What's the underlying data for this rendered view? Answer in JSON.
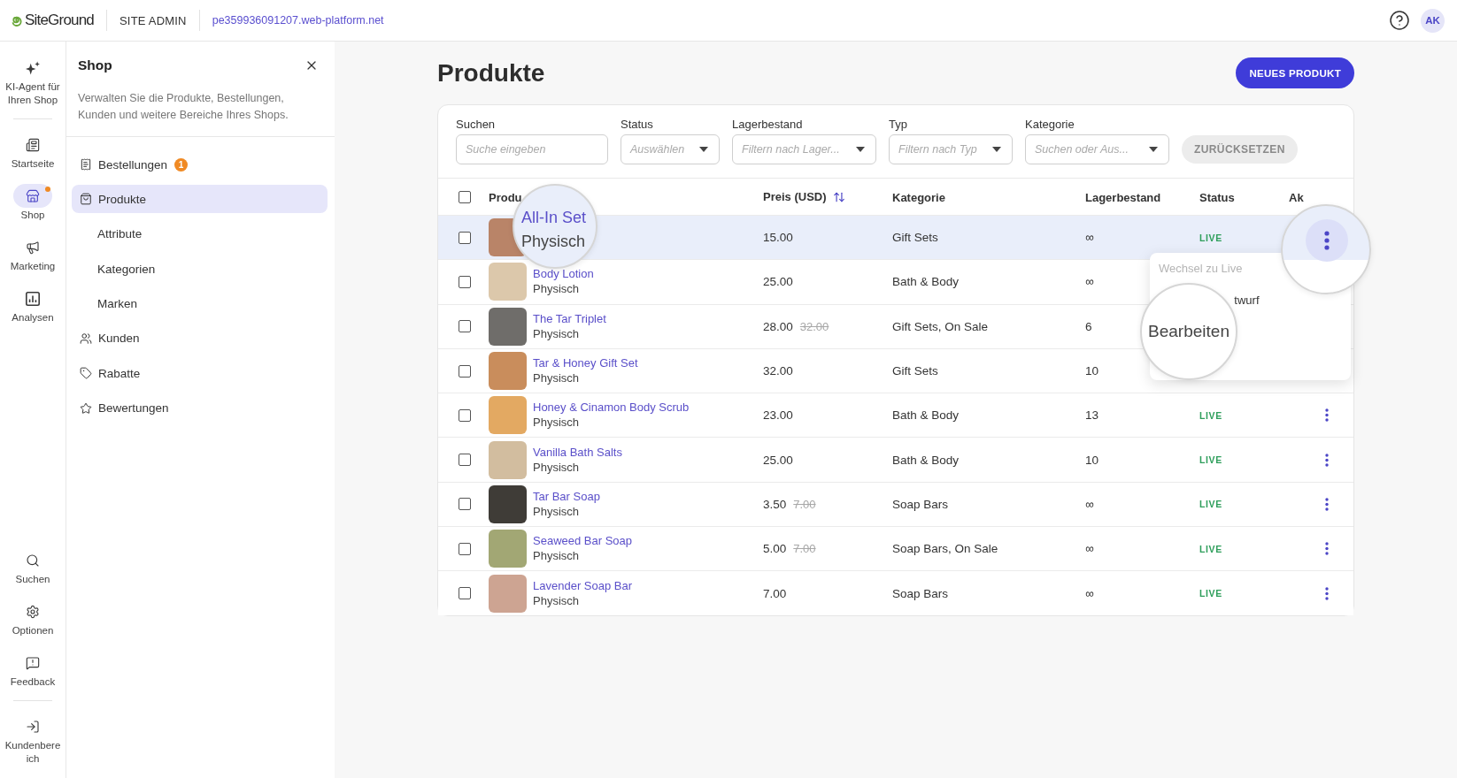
{
  "header": {
    "logo": "SiteGround",
    "section": "SITE ADMIN",
    "domain": "pe359936091207.web-platform.net",
    "avatar": "AK"
  },
  "rail": {
    "top_sections": [
      {
        "items": [
          {
            "label": "KI-Agent für Ihren Shop",
            "selected": false,
            "notification": false
          }
        ]
      },
      {
        "items": [
          {
            "label": "Startseite",
            "selected": false,
            "notification": false
          },
          {
            "label": "Shop",
            "selected": true,
            "notification": true
          },
          {
            "label": "Marketing",
            "selected": false,
            "notification": false
          },
          {
            "label": "Analysen",
            "selected": false,
            "notification": false
          }
        ]
      }
    ],
    "bottom_sections": [
      {
        "items": [
          {
            "label": "Suchen",
            "selected": false,
            "notification": false
          },
          {
            "label": "Optionen",
            "selected": false,
            "notification": false
          },
          {
            "label": "Feedback",
            "selected": false,
            "notification": false
          }
        ]
      },
      {
        "items": [
          {
            "label": "Kundenbereich",
            "selected": false,
            "notification": false
          }
        ]
      }
    ]
  },
  "shop_panel": {
    "title": "Shop",
    "description": "Verwalten Sie die Produkte, Bestellungen, Kunden und weitere Bereiche Ihres Shops.",
    "items": [
      {
        "label": "Bestellungen",
        "badge": "1",
        "selected": false
      },
      {
        "label": "Produkte",
        "selected": true,
        "children": [
          {
            "label": "Attribute",
            "selected": false
          },
          {
            "label": "Kategorien",
            "selected": false
          },
          {
            "label": "Marken",
            "selected": false
          }
        ]
      },
      {
        "label": "Kunden",
        "selected": false
      },
      {
        "label": "Rabatte",
        "selected": false
      },
      {
        "label": "Bewertungen",
        "selected": false
      }
    ]
  },
  "main": {
    "title": "Produkte",
    "new_button": "NEUES PRODUKT",
    "filters": [
      {
        "kind": "text",
        "label": "Suchen",
        "placeholder": "Suche eingeben"
      },
      {
        "kind": "select",
        "label": "Status",
        "placeholder": "Auswählen"
      },
      {
        "kind": "select",
        "label": "Lagerbestand",
        "placeholder": "Filtern nach Lager..."
      },
      {
        "kind": "select",
        "label": "Typ",
        "placeholder": "Filtern nach Typ"
      },
      {
        "kind": "select",
        "label": "Kategorie",
        "placeholder": "Suchen oder Aus..."
      }
    ],
    "reset_button": {
      "label": "ZURÜCKSETZEN",
      "disabled": true
    },
    "table": {
      "select_all": {
        "checked": false
      },
      "columns": [
        {
          "label": "Produ"
        },
        {
          "label": "Preis (USD)",
          "sortable": true
        },
        {
          "label": "Kategorie"
        },
        {
          "label": "Lagerbestand"
        },
        {
          "label": "Status"
        },
        {
          "label": "Ak"
        }
      ],
      "rows": [
        {
          "checked": false,
          "selected": true,
          "price": "15.00",
          "category": "Gift Sets",
          "stock": "∞",
          "status": "LIVE"
        },
        {
          "checked": false,
          "selected": false,
          "name": "Body Lotion",
          "type": "Physisch",
          "price": "25.00",
          "category": "Bath & Body",
          "stock": "∞"
        },
        {
          "checked": false,
          "selected": false,
          "name": "The Tar Triplet",
          "type": "Physisch",
          "price": "28.00",
          "old_price": "32.00",
          "category": "Gift Sets, On Sale",
          "stock": "6"
        },
        {
          "checked": false,
          "selected": false,
          "name": "Tar & Honey Gift Set",
          "type": "Physisch",
          "price": "32.00",
          "category": "Gift Sets",
          "stock": "10"
        },
        {
          "checked": false,
          "selected": false,
          "name": "Honey & Cinamon Body Scrub",
          "type": "Physisch",
          "price": "23.00",
          "category": "Bath & Body",
          "stock": "13",
          "status": "LIVE",
          "has_actions": true
        },
        {
          "checked": false,
          "selected": false,
          "name": "Vanilla Bath Salts",
          "type": "Physisch",
          "price": "25.00",
          "category": "Bath & Body",
          "stock": "10",
          "status": "LIVE",
          "has_actions": true
        },
        {
          "checked": false,
          "selected": false,
          "name": "Tar Bar Soap",
          "type": "Physisch",
          "price": "3.50",
          "old_price": "7.00",
          "category": "Soap Bars",
          "stock": "∞",
          "status": "LIVE",
          "has_actions": true
        },
        {
          "checked": false,
          "selected": false,
          "name": "Seaweed Bar Soap",
          "type": "Physisch",
          "price": "5.00",
          "old_price": "7.00",
          "category": "Soap Bars, On Sale",
          "stock": "∞",
          "status": "LIVE",
          "has_actions": true
        },
        {
          "checked": false,
          "selected": false,
          "name": "Lavender Soap Bar",
          "type": "Physisch",
          "price": "7.00",
          "category": "Soap Bars",
          "stock": "∞",
          "status": "LIVE",
          "has_actions": true
        }
      ],
      "magnifiers": [
        {
          "kind": "product",
          "title": "All-In Set",
          "subtitle": "Physisch"
        },
        {
          "kind": "action_button"
        }
      ],
      "action_menu": {
        "items": [
          {
            "label": "Wechsel zu Live",
            "disabled": true
          },
          {
            "label": "twurf",
            "disabled": false
          }
        ],
        "magnifier": {
          "label": "Bearbeiten"
        }
      }
    }
  }
}
